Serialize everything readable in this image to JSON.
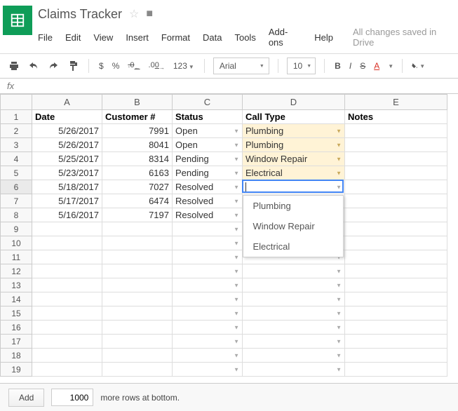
{
  "doc": {
    "title": "Claims Tracker",
    "save_status": "All changes saved in Drive"
  },
  "menu": {
    "file": "File",
    "edit": "Edit",
    "view": "View",
    "insert": "Insert",
    "format": "Format",
    "data": "Data",
    "tools": "Tools",
    "addons": "Add-ons",
    "help": "Help"
  },
  "toolbar": {
    "currency": "$",
    "percent": "%",
    "dec_dec": ".0",
    "inc_dec": ".00",
    "more_formats": "123",
    "font": "Arial",
    "size": "10",
    "bold": "B",
    "italic": "I",
    "strike": "S",
    "textcolor": "A"
  },
  "fx": {
    "label": "fx"
  },
  "columns": {
    "A": "A",
    "B": "B",
    "C": "C",
    "D": "D",
    "E": "E"
  },
  "headers": {
    "date": "Date",
    "customer": "Customer #",
    "status": "Status",
    "calltype": "Call Type",
    "notes": "Notes"
  },
  "rows": [
    {
      "date": "5/26/2017",
      "customer": "7991",
      "status": "Open",
      "calltype": "Plumbing",
      "hl": true
    },
    {
      "date": "5/26/2017",
      "customer": "8041",
      "status": "Open",
      "calltype": "Plumbing",
      "hl": true
    },
    {
      "date": "5/25/2017",
      "customer": "8314",
      "status": "Pending",
      "calltype": "Window Repair",
      "hl": true
    },
    {
      "date": "5/23/2017",
      "customer": "6163",
      "status": "Pending",
      "calltype": "Electrical",
      "hl": true
    },
    {
      "date": "5/18/2017",
      "customer": "7027",
      "status": "Resolved",
      "calltype": "",
      "hl": false,
      "active": true
    },
    {
      "date": "5/17/2017",
      "customer": "6474",
      "status": "Resolved",
      "calltype": "",
      "hl": false
    },
    {
      "date": "5/16/2017",
      "customer": "7197",
      "status": "Resolved",
      "calltype": "",
      "hl": false
    }
  ],
  "dropdown": {
    "options": [
      "Plumbing",
      "Window Repair",
      "Electrical"
    ]
  },
  "footer": {
    "add": "Add",
    "count": "1000",
    "suffix": "more rows at bottom."
  },
  "colwidths": {
    "A": 100,
    "B": 100,
    "C": 100,
    "D": 146,
    "E": 146
  }
}
